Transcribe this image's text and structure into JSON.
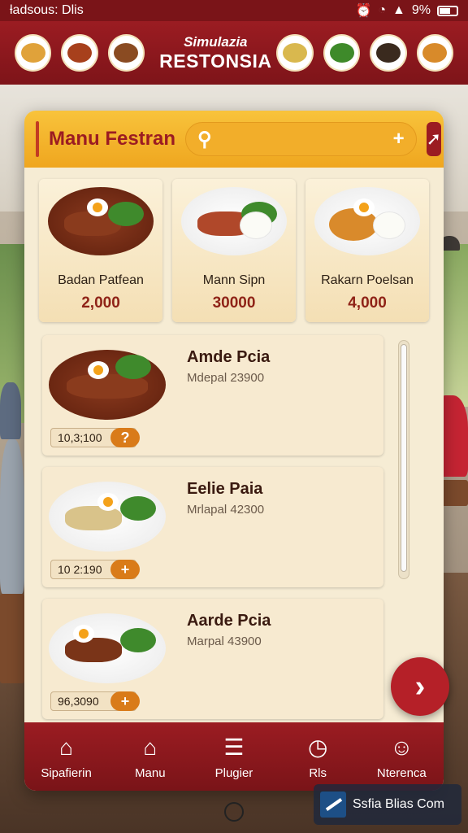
{
  "status_bar": {
    "left_text": "ƚadsous: Dlis",
    "battery": "9%"
  },
  "header": {
    "brand_top": "Simulazia",
    "brand_main": "RESTONSIA",
    "thumbs_left": [
      "dish-1",
      "dish-2",
      "dish-3"
    ],
    "thumbs_right": [
      "dish-4",
      "dish-5",
      "dish-6",
      "dish-7"
    ]
  },
  "panel": {
    "title": "Manu Festran",
    "search": {
      "placeholder": ""
    }
  },
  "featured": [
    {
      "name": "Badan Patfean",
      "price": "2,000"
    },
    {
      "name": "Mann Sipn",
      "price": "30000"
    },
    {
      "name": "Rakarn Poelsan",
      "price": "4,000"
    }
  ],
  "items": [
    {
      "name": "Amde Pcia",
      "desc": "Mdepal 23900",
      "price": "10,3;100",
      "action": "?"
    },
    {
      "name": "Eelie Paia",
      "desc": "Mrlapal 42300",
      "price": "10 2:190",
      "action": "+"
    },
    {
      "name": "Aarde Pcia",
      "desc": "Marpal 43900",
      "price": "96,3090",
      "action": "+"
    }
  ],
  "nav": [
    {
      "label": "Sipafierin",
      "icon": "home-icon"
    },
    {
      "label": "Manu",
      "icon": "home-outline-icon"
    },
    {
      "label": "Plugier",
      "icon": "document-icon"
    },
    {
      "label": "Rls",
      "icon": "clock-icon"
    },
    {
      "label": "Nterenca",
      "icon": "user-icon"
    }
  ],
  "watermark": {
    "text": "Ssfia Blias Com"
  },
  "colors": {
    "brand_red": "#9b1c22",
    "accent_yellow": "#f2ae2a",
    "accent_orange": "#d97b19",
    "panel_bg": "#f6ecd4"
  }
}
